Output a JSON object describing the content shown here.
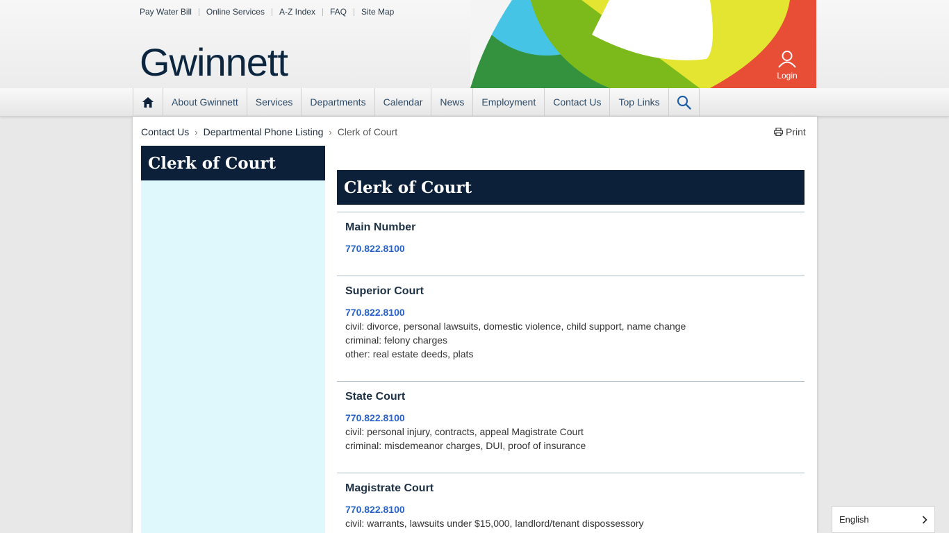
{
  "utility": {
    "links": [
      "Pay Water Bill",
      "Online Services",
      "A-Z Index",
      "FAQ",
      "Site Map"
    ]
  },
  "brand": {
    "logo_text": "Gwinnett"
  },
  "login": {
    "label": "Login",
    "icon": "user-icon"
  },
  "nav": {
    "home_icon": "home-icon",
    "items": [
      "About Gwinnett",
      "Services",
      "Departments",
      "Calendar",
      "News",
      "Employment",
      "Contact Us",
      "Top Links"
    ],
    "search_icon": "search-icon"
  },
  "breadcrumb": {
    "items": [
      "Contact Us",
      "Departmental Phone Listing"
    ],
    "current": "Clerk of Court"
  },
  "print": {
    "label": "Print",
    "icon": "printer-icon"
  },
  "sidebar": {
    "title": "Clerk of Court"
  },
  "main": {
    "title": "Clerk of Court",
    "entries": [
      {
        "heading": "Main Number",
        "phone": "770.822.8100",
        "lines": []
      },
      {
        "heading": "Superior Court",
        "phone": "770.822.8100",
        "lines": [
          "civil: divorce, personal lawsuits, domestic violence, child support, name change",
          "criminal: felony charges",
          "other: real estate deeds, plats"
        ]
      },
      {
        "heading": "State Court",
        "phone": "770.822.8100",
        "lines": [
          "civil: personal injury, contracts, appeal Magistrate Court",
          "criminal: misdemeanor charges, DUI, proof of insurance"
        ]
      },
      {
        "heading": "Magistrate Court",
        "phone": "770.822.8100",
        "lines": [
          "civil: warrants, lawsuits under $15,000, landlord/tenant dispossessory"
        ]
      }
    ]
  },
  "language": {
    "selected": "English"
  },
  "colors": {
    "navy": "#0c203a",
    "link_blue": "#2962c7",
    "sidebar_bg": "#dff8fc",
    "art_green": "#34923f",
    "art_lime": "#7cba1c",
    "art_yellow": "#e3e531",
    "art_red": "#e84d35",
    "art_cyan": "#45c4e6"
  }
}
